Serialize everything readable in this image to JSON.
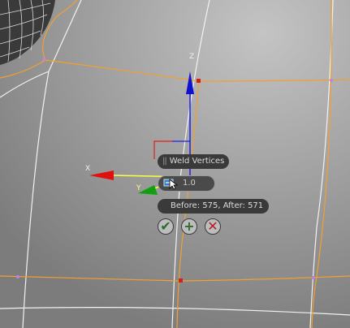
{
  "viewport": {
    "axes": {
      "x_label": "X",
      "y_label": "Y",
      "z_label": "Z"
    }
  },
  "caddy": {
    "title": "Weld Vertices",
    "threshold_value": "1.0",
    "info_text": "Before: 575, After: 571",
    "buttons": {
      "ok": "✔",
      "apply_continue": "+",
      "cancel": "✕"
    },
    "colors": {
      "panel": "#3a3a3a",
      "ok": "#2f6b2f",
      "cancel": "#b02020"
    }
  }
}
